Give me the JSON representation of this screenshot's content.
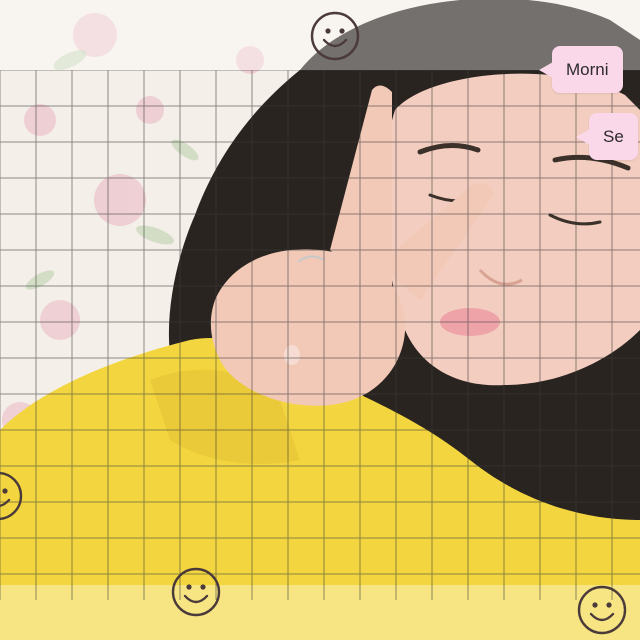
{
  "photo": {
    "subject": "person",
    "gesture": "peace-sign",
    "sweater_color": "#f3d63f",
    "wallpaper_color": "#f4efe9",
    "floral_color": "#e9b9c3",
    "hair_color": "#2a2420",
    "skin_color": "#f3cdbf"
  },
  "overlay": {
    "grid_color": "#3a3a3a",
    "band_color": "#ffffff"
  },
  "chat_bubbles": [
    {
      "text": "Morni"
    },
    {
      "text": "Se"
    }
  ],
  "stickers": [
    {
      "icon": "smiley-face-icon"
    },
    {
      "icon": "smiley-face-icon"
    },
    {
      "icon": "smiley-face-icon"
    },
    {
      "icon": "smiley-face-icon"
    }
  ]
}
